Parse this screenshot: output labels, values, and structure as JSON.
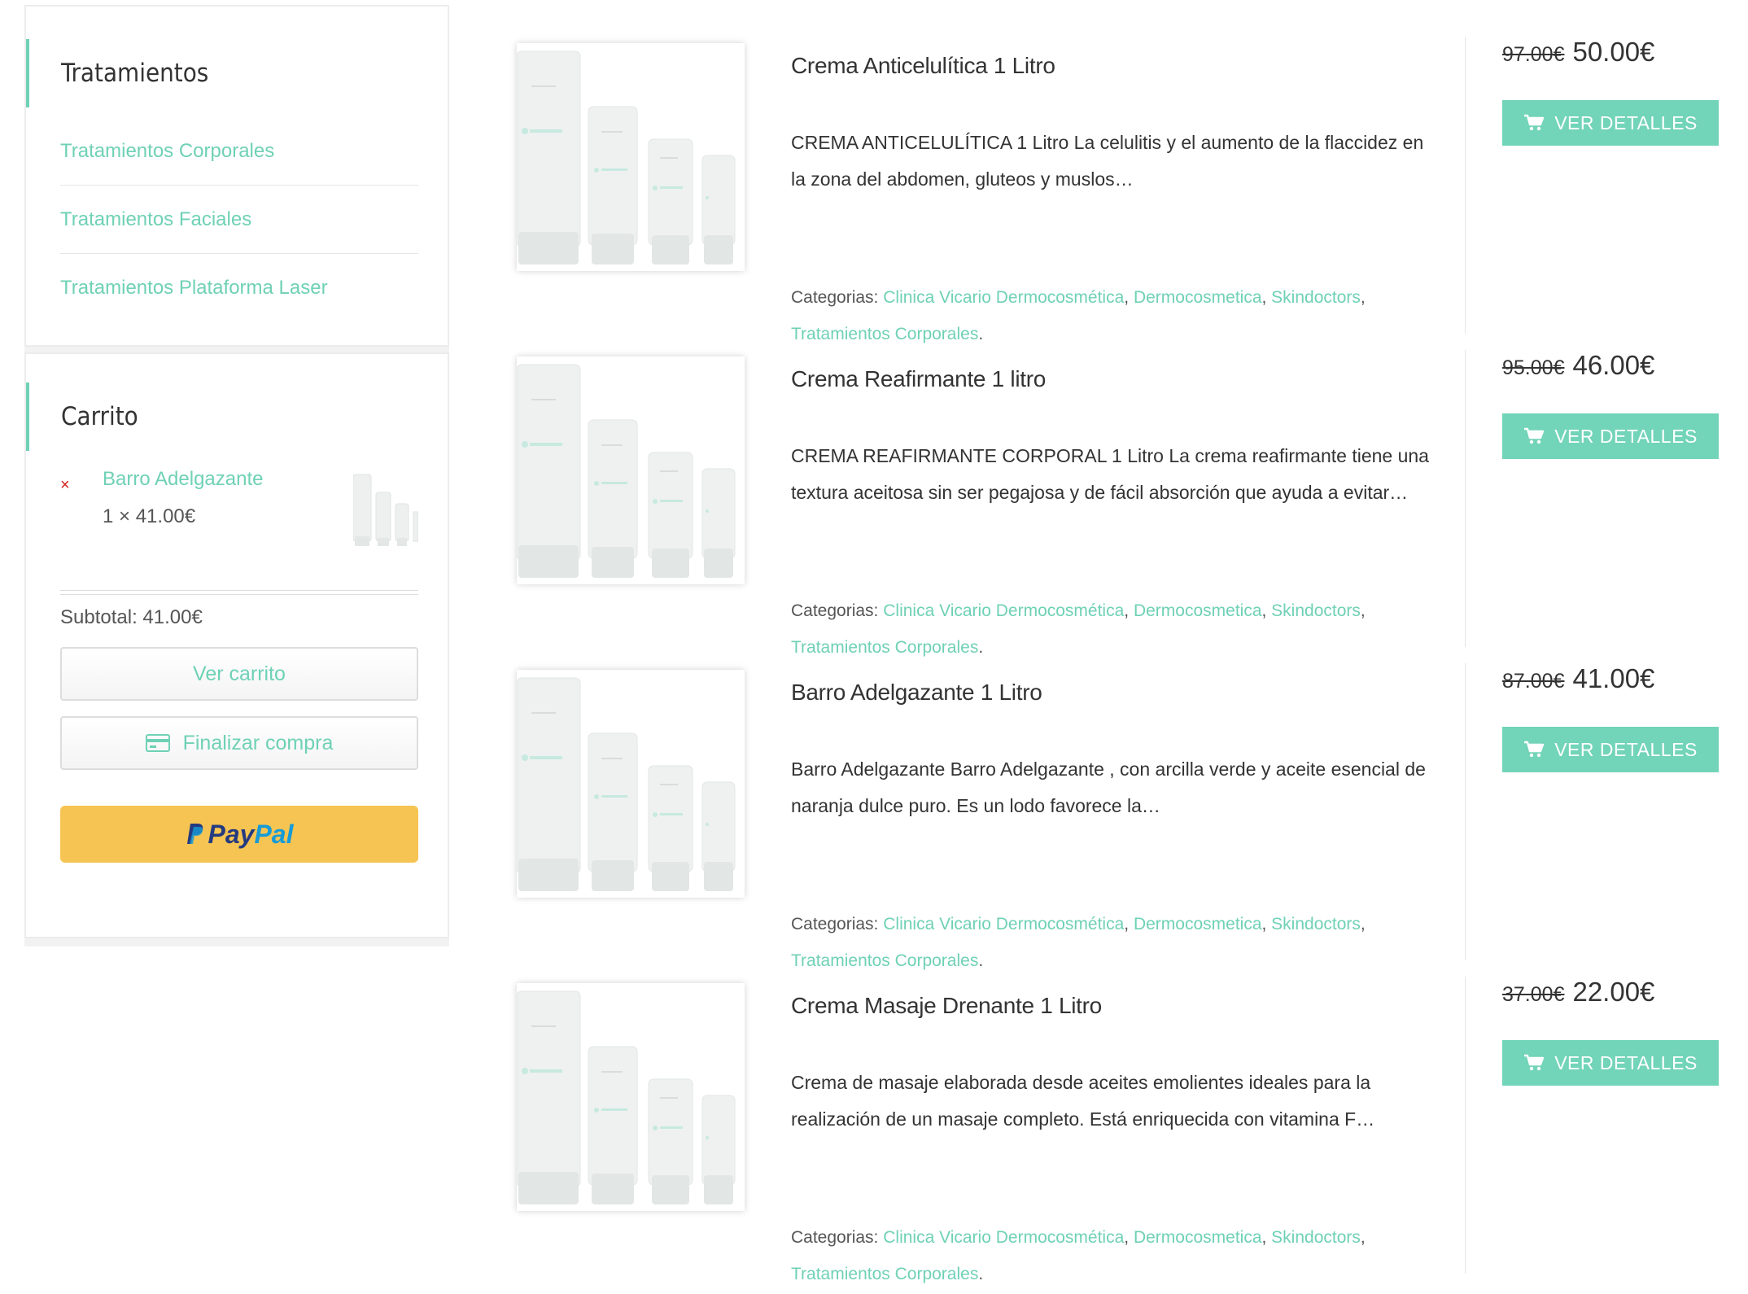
{
  "sidebar": {
    "treatments": {
      "title": "Tratamientos",
      "items": [
        {
          "label": "Tratamientos Corporales"
        },
        {
          "label": "Tratamientos Faciales"
        },
        {
          "label": "Tratamientos Plataforma Laser"
        }
      ]
    },
    "cart": {
      "title": "Carrito",
      "remove_symbol": "×",
      "item_name": "Barro Adelgazante",
      "item_qty": "1 × 41.00€",
      "subtotal_label": "Subtotal:",
      "subtotal_value": "41.00€",
      "view_cart_label": "Ver carrito",
      "checkout_label": "Finalizar compra",
      "paypal_a": "Pay",
      "paypal_b": "Pal"
    }
  },
  "products": [
    {
      "title": "Crema Anticelulítica 1 Litro",
      "desc": "CREMA ANTICELULÍTICA 1 Litro La celulitis y el aumento de la flaccidez en la zona del abdomen, gluteos y muslos…",
      "cats_label": "Categorias:",
      "cats": [
        "Clinica Vicario Dermocosmética",
        "Dermocosmetica",
        "Skindoctors",
        "Tratamientos Corporales"
      ],
      "old_price": "97.00€",
      "price": "50.00€",
      "button": "VER DETALLES"
    },
    {
      "title": "Crema Reafirmante 1 litro",
      "desc": "CREMA REAFIRMANTE CORPORAL 1 Litro La crema reafirmante tiene una textura aceitosa sin ser pegajosa y de fácil absorción que ayuda a evitar…",
      "cats_label": "Categorias:",
      "cats": [
        "Clinica Vicario Dermocosmética",
        "Dermocosmetica",
        "Skindoctors",
        "Tratamientos Corporales"
      ],
      "old_price": "95.00€",
      "price": "46.00€",
      "button": "VER DETALLES"
    },
    {
      "title": "Barro Adelgazante 1 Litro",
      "desc": "Barro Adelgazante Barro Adelgazante , con arcilla verde y aceite esencial de naranja dulce puro. Es un lodo favorece la…",
      "cats_label": "Categorias:",
      "cats": [
        "Clinica Vicario Dermocosmética",
        "Dermocosmetica",
        "Skindoctors",
        "Tratamientos Corporales"
      ],
      "old_price": "87.00€",
      "price": "41.00€",
      "button": "VER DETALLES"
    },
    {
      "title": "Crema Masaje Drenante 1 Litro",
      "desc": "Crema de masaje elaborada desde aceites emolientes ideales para la realización de un masaje completo. Está enriquecida con vitamina F…",
      "cats_label": "Categorias:",
      "cats": [
        "Clinica Vicario Dermocosmética",
        "Dermocosmetica",
        "Skindoctors",
        "Tratamientos Corporales"
      ],
      "old_price": "37.00€",
      "price": "22.00€",
      "button": "VER DETALLES"
    }
  ],
  "colors": {
    "accent": "#6fd1b5",
    "button": "#72d4b8",
    "paypal_bg": "#f6c452",
    "remove": "#d0221a"
  },
  "icons": [
    "cart-icon",
    "credit-card-icon",
    "remove-icon",
    "product-tubes-image"
  ]
}
